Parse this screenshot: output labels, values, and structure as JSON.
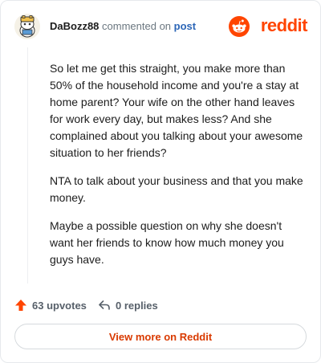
{
  "header": {
    "username": "DaBozz88",
    "commented_on": "commented on",
    "post_link": "post",
    "brand": "reddit"
  },
  "comment": {
    "paragraphs": [
      "So let me get this straight, you make more than 50% of the household income and you're a stay at home parent? Your wife on the other hand leaves for work every day, but makes less? And she complained about you talking about your awesome situation to her friends?",
      "NTA to talk about your business and that you make money.",
      "Maybe a possible question on why she doesn't want her friends to know how much money you guys have."
    ]
  },
  "actions": {
    "upvotes_label": "63 upvotes",
    "replies_label": "0 replies"
  },
  "footer": {
    "view_more_label": "View more on Reddit"
  },
  "colors": {
    "brand": "#ff4500",
    "upvote": "#ff4500",
    "link": "#2c66b7",
    "cta": "#d93a00"
  },
  "icons": {
    "avatar": "snoo-avatar-icon",
    "brand": "reddit-alien-icon",
    "upvote": "upvote-arrow-icon",
    "reply": "reply-arrow-icon"
  }
}
